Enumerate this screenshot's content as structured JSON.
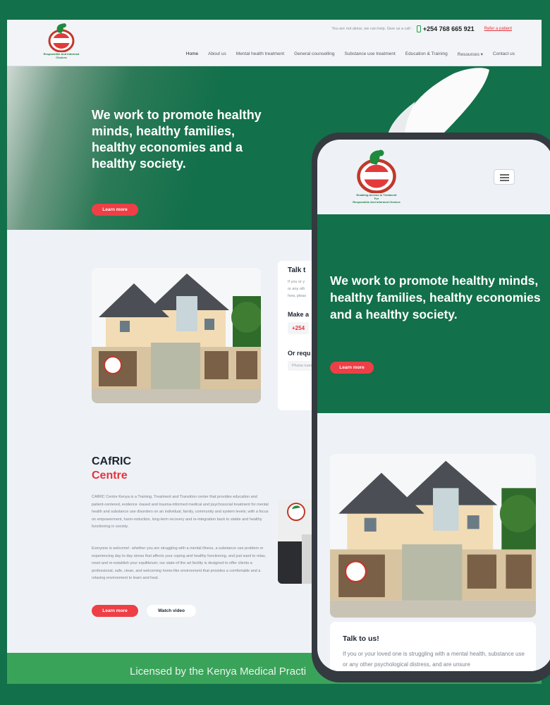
{
  "brand": {
    "logo_text": "CAfRIC",
    "logo_tagline_1": "Enabling Access to Treatment",
    "logo_tagline_2": "For",
    "logo_tagline_3": "Responsible And Informed Choices"
  },
  "topbar": {
    "support_text": "You are not alone, we can help. Give us a call :",
    "phone": "+254 768 665 921",
    "refer_link": "Refer a patient"
  },
  "nav": {
    "items": [
      {
        "label": "Home"
      },
      {
        "label": "About us"
      },
      {
        "label": "Mental health treatment"
      },
      {
        "label": "General counselling"
      },
      {
        "label": "Substance use treatment"
      },
      {
        "label": "Education & Training"
      },
      {
        "label": "Resources ▾"
      },
      {
        "label": "Contact us"
      }
    ]
  },
  "hero": {
    "title": "We work to promote healthy minds, healthy families, healthy economies and a healthy society.",
    "cta": "Learn more"
  },
  "talk": {
    "heading_partial": "Talk t",
    "line1": "If you or y",
    "line2": "or any oth",
    "line3": "how, pleas",
    "appt_heading": "Make a",
    "appt_phone": "+254",
    "request_heading": "Or requ",
    "phone_placeholder": "Phone num"
  },
  "about": {
    "title_1": "CAfRIC",
    "title_2": "Centre",
    "paragraph_1": "CAfRIC Centre Kenya is a Training, Treatment and Transition center that provides education and patient-centered, evidence -based and trauma-informed medical and psychosocial treatment for mental health and substance use disorders on an individual, family, community and system levels; with a focus on empowerment, harm-reduction, long-term recovery and re-integration back to stable and healthy functioning in society.",
    "paragraph_2": "Everyone is welcome!- whether you are struggling with a mental illness, a substance use problem or experiencing day to day stress that affects your coping and healthy functioning, and just want to relax, reset and re-establish your equilibrium; our state-of the art facility is designed to offer clients a professional, safe, clean, and welcoming home-like environment that provides a comfortable and a relaxing environment to learn and heal.",
    "learn_more": "Learn more",
    "watch_video": "Watch video"
  },
  "footer": {
    "licensed_text": "Licensed by the Kenya Medical Practi"
  },
  "mobile": {
    "hero_title": "We work to promote healthy minds, healthy families, healthy economies and a healthy society.",
    "hero_cta": "Learn more",
    "talk_heading": "Talk to us!",
    "talk_text": "If you or your loved one is struggling with a mental health, substance use or any other psychological distress, and are unsure"
  },
  "colors": {
    "brand_green": "#12704a",
    "accent_red": "#ee3f46",
    "page_bg": "#eef2f7"
  },
  "icons": [
    "phone-icon",
    "dove-logo-icon",
    "hamburger-menu-icon",
    "dropdown-caret-icon"
  ]
}
